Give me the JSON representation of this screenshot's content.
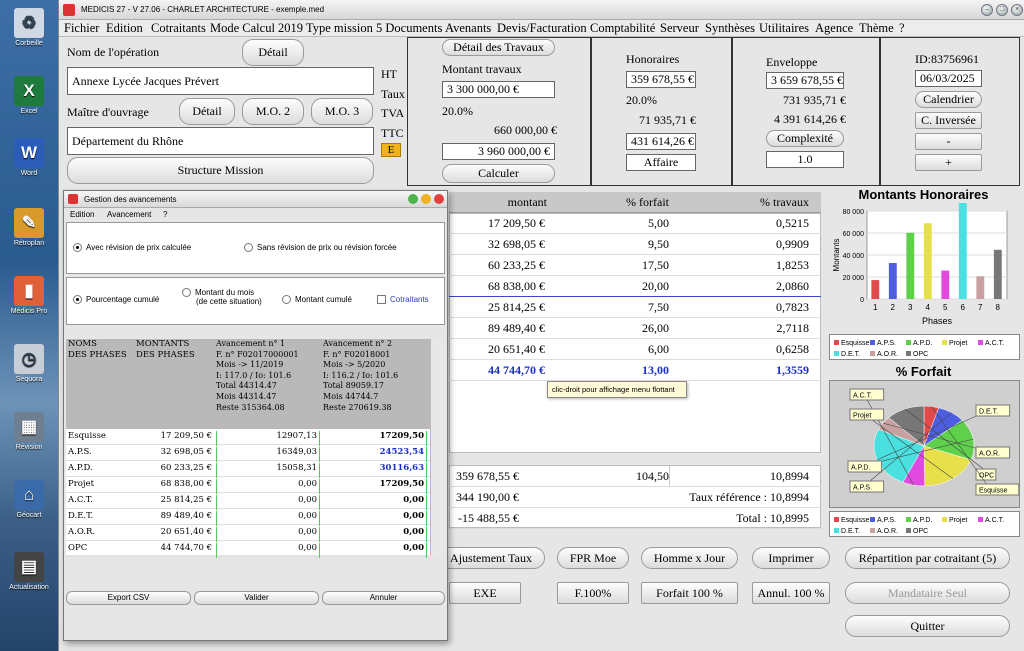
{
  "desktop": {
    "icons": [
      "Corbeille",
      "Excel",
      "Word",
      "Rétroplan",
      "Médicis Pro",
      "Séquora",
      "Révision",
      "Géocart",
      "Actualisation"
    ]
  },
  "window": {
    "title": "MEDICIS 27 - V 27.06 - CHARLET ARCHITECTURE - exemple.med"
  },
  "menu": [
    "Fichier",
    "Edition",
    "Cotraitants",
    "Mode Calcul 2019",
    "Type mission",
    "5 Documents",
    "Avenants",
    "Devis/Facturation",
    "Comptabilité",
    "Serveur",
    "Synthèses",
    "Utilitaires",
    "Agence",
    "Thème",
    "?"
  ],
  "left": {
    "nom_label": "Nom de l'opération",
    "detail": "Détail",
    "nom_value": "Annexe Lycée Jacques Prévert",
    "mo_label": "Maître d'ouvrage",
    "detail2": "Détail",
    "mo2": "M.O. 2",
    "mo3": "M.O. 3",
    "mo_value": "Département du Rhône",
    "structure": "Structure Mission"
  },
  "tax_labels": {
    "ht": "HT",
    "taux": "Taux",
    "tva": "TVA",
    "ttc": "TTC",
    "e": "E"
  },
  "travaux": {
    "detail_btn": "Détail des Travaux",
    "montant_label": "Montant travaux",
    "ht": "3 300 000,00 €",
    "taux": "20.0%",
    "tva": "660 000,00 €",
    "ttc": "3 960 000,00 €",
    "calc_btn": "Calculer"
  },
  "honoraires": {
    "title": "Honoraires",
    "ht": "359 678,55 €",
    "taux": "20.0%",
    "tva": "71 935,71 €",
    "ttc": "431 614,26 €",
    "affaire": "Affaire"
  },
  "enveloppe": {
    "title": "Enveloppe",
    "ht": "3 659 678,55 €",
    "tva": "731 935,71 €",
    "ttc": "4 391 614,26 €",
    "complexite": "Complexité",
    "complexite_value": "1.0"
  },
  "idpanel": {
    "id": "ID:83756961",
    "date": "06/03/2025",
    "calendrier": "Calendrier",
    "cinversee": "C. Inversée",
    "minus": "-",
    "plus": "+"
  },
  "grid": {
    "headers": [
      "montant",
      "% forfait",
      "% travaux"
    ],
    "rows": [
      [
        "17 209,50 €",
        "5,00",
        "0,5215"
      ],
      [
        "32 698,05 €",
        "9,50",
        "0,9909"
      ],
      [
        "60 233,25 €",
        "17,50",
        "1,8253"
      ],
      [
        "68 838,00 €",
        "20,00",
        "2,0860"
      ],
      [
        "25 814,25 €",
        "7,50",
        "0,7823"
      ],
      [
        "89 489,40 €",
        "26,00",
        "2,7118"
      ],
      [
        "20 651,40 €",
        "6,00",
        "0,6258"
      ]
    ],
    "total": [
      "44 744,70 €",
      "13,00",
      "1,3559"
    ],
    "tooltip": "clic-droit pour affichage menu flottant",
    "summary": [
      [
        "359 678,55 €",
        "104,50",
        "10,8994"
      ],
      [
        "344 190,00 €",
        "",
        "Taux référence : 10,8994"
      ],
      [
        "-15 488,55 €",
        "",
        "Total : 10,8995"
      ]
    ]
  },
  "buttons": {
    "ajust": "Ajustement Taux",
    "fpr": "FPR Moe",
    "hj": "Homme x Jour",
    "imprimer": "Imprimer",
    "repartition": "Répartition par cotraitant (5)",
    "exe": "EXE",
    "f100": "F.100%",
    "forfait100": "Forfait 100 %",
    "annul": "Annul. 100 %",
    "mandataire": "Mandataire Seul",
    "quitter": "Quitter"
  },
  "chart_data": [
    {
      "type": "bar",
      "title": "Montants Honoraires",
      "xlabel": "Phases",
      "ylabel": "Montants",
      "categories": [
        "1",
        "2",
        "3",
        "4",
        "5",
        "6",
        "7",
        "8"
      ],
      "values": [
        17209.5,
        32698.05,
        60233.25,
        68838,
        25814.25,
        89489.4,
        20651.4,
        44744.7
      ],
      "ylim": [
        0,
        80000
      ],
      "yticks": [
        "0",
        "20 000",
        "40 000",
        "60 000",
        "80 000"
      ],
      "colors": [
        "#e04a4a",
        "#4d5ee0",
        "#5fd04a",
        "#e8e04a",
        "#e04ae0",
        "#4ae0e0",
        "#c8a0a0",
        "#777777"
      ],
      "legend": [
        "Esquisse",
        "A.P.S.",
        "A.P.D.",
        "Projet",
        "A.C.T.",
        "D.E.T.",
        "A.O.R.",
        "OPC"
      ],
      "grid": true
    },
    {
      "type": "pie",
      "title": "% Forfait",
      "categories": [
        "Esquisse",
        "A.P.S.",
        "A.P.D.",
        "Projet",
        "A.C.T.",
        "D.E.T.",
        "A.O.R.",
        "OPC"
      ],
      "values": [
        5,
        9.5,
        17.5,
        20,
        7.5,
        26,
        6,
        13
      ],
      "colors": [
        "#e04a4a",
        "#4d5ee0",
        "#5fd04a",
        "#e8e04a",
        "#e04ae0",
        "#4ae0e0",
        "#c8a0a0",
        "#777777"
      ],
      "legend": [
        "Esquisse",
        "A.P.S.",
        "A.P.D.",
        "Projet",
        "A.C.T.",
        "D.E.T.",
        "A.O.R.",
        "OPC"
      ],
      "callouts": [
        "A.C.T.",
        "D.E.T.",
        "Projet",
        "A.O.R.",
        "OPC",
        "A.P.D.",
        "Esquisse",
        "A.P.S."
      ]
    }
  ],
  "sub": {
    "title": "Gestion des avancements",
    "menu": [
      "Edition",
      "Avancement",
      "?"
    ],
    "radio1": "Avec révision de prix calculée",
    "radio2": "Sans révision de prix ou révision forcée",
    "opt1": "Pourcentage cumulé",
    "opt2a": "Montant du mois",
    "opt2b": "(de cette situation)",
    "opt3": "Montant cumulé",
    "cotraitants": "Cotraitants",
    "h_noms": [
      "NOMS",
      "DES PHASES"
    ],
    "h_montants": [
      "MONTANTS",
      "DES PHASES"
    ],
    "av1": [
      "Avancement n° 1",
      "F. n° F02017000001",
      "Mois -> 11/2019",
      "I: 117.0 / Io: 101.6",
      "Total 44314.47",
      "Mois 44314.47",
      "Reste  315364.08"
    ],
    "av2": [
      "Avancement n° 2",
      "F. n° F02018001",
      "Mois -> 5/2020",
      "I: 116.2 / Io: 101.6",
      "Total 89059.17",
      "Mois 44744.7",
      "Reste  270619.38"
    ],
    "rows": [
      [
        "Esquisse",
        "17 209,50 €",
        "12907,13",
        "17209,50"
      ],
      [
        "A.P.S.",
        "32 698,05 €",
        "16349,03",
        "24523,54"
      ],
      [
        "A.P.D.",
        "60 233,25 €",
        "15058,31",
        "30116,63"
      ],
      [
        "Projet",
        "68 838,00 €",
        "0,00",
        "17209,50"
      ],
      [
        "A.C.T.",
        "25 814,25 €",
        "0,00",
        "0,00"
      ],
      [
        "D.E.T.",
        "89 489,40 €",
        "0,00",
        "0,00"
      ],
      [
        "A.O.R.",
        "20 651,40 €",
        "0,00",
        "0,00"
      ],
      [
        "OPC",
        "44 744,70 €",
        "0,00",
        "0,00"
      ]
    ],
    "export": "Export CSV",
    "valider": "Valider",
    "annuler": "Annuler"
  }
}
